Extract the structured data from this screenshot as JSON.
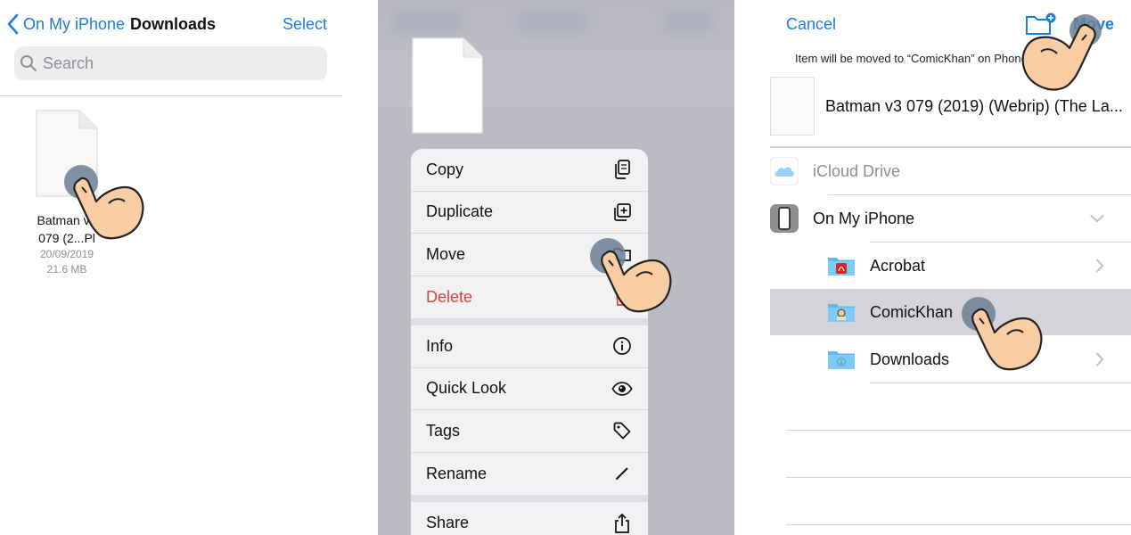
{
  "panel1": {
    "back_label": "On My iPhone",
    "title": "Downloads",
    "select_label": "Select",
    "search_placeholder": "Search",
    "file": {
      "name_line1": "Batman v3",
      "name_line2": "079 (2...Pl",
      "date": "20/09/2019",
      "size": "21.6 MB"
    }
  },
  "panel2": {
    "menu_group1": [
      {
        "label": "Copy",
        "icon": "copy-icon"
      },
      {
        "label": "Duplicate",
        "icon": "duplicate-icon"
      },
      {
        "label": "Move",
        "icon": "folder-icon"
      },
      {
        "label": "Delete",
        "icon": "trash-icon"
      }
    ],
    "menu_group2": [
      {
        "label": "Info",
        "icon": "info-icon"
      },
      {
        "label": "Quick Look",
        "icon": "eye-icon"
      },
      {
        "label": "Tags",
        "icon": "tag-icon"
      },
      {
        "label": "Rename",
        "icon": "pencil-icon"
      }
    ],
    "menu_group3": [
      {
        "label": "Share",
        "icon": "share-icon"
      }
    ]
  },
  "panel3": {
    "cancel_label": "Cancel",
    "move_label": "Move",
    "notice": "Item will be moved to “ComicKhan” on        Phone.",
    "item_name": "Batman v3 079 (2019) (Webrip) (The La...",
    "locations": {
      "icloud": "iCloud Drive",
      "on_my_iphone": "On My iPhone",
      "acrobat": "Acrobat",
      "comickhan": "ComicKhan",
      "downloads": "Downloads"
    }
  },
  "colors": {
    "accent": "#1a7ee6",
    "danger": "#e0413a",
    "folder": "#5db9f0"
  }
}
